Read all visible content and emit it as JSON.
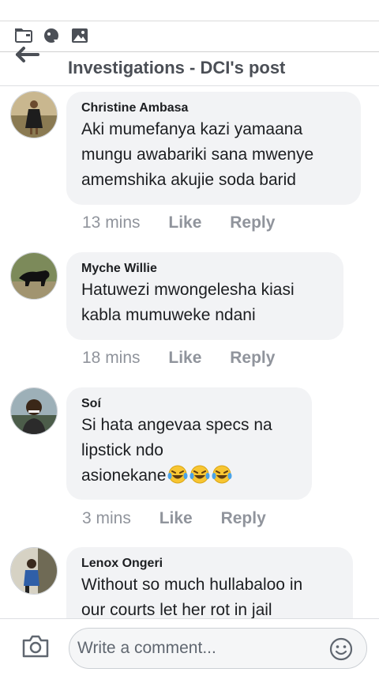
{
  "header": {
    "title": "Investigations - DCI's post"
  },
  "comments": [
    {
      "author": "Christine Ambasa",
      "lines": [
        "Aki mumefanya kazi yamaana",
        "mungu awabariki sana mwenye",
        "amemshika akujie soda barid"
      ],
      "time": "13 mins",
      "like": "Like",
      "reply": "Reply"
    },
    {
      "author": "Myche Willie",
      "lines": [
        "Hatuwezi mwongelesha kiasi",
        "kabla mumuweke ndani"
      ],
      "time": "18 mins",
      "like": "Like",
      "reply": "Reply"
    },
    {
      "author": "Soí",
      "lines": [
        "Si hata angevaa specs na",
        "lipstick ndo",
        "asionekane"
      ],
      "emoji": "laughing-tears",
      "time": "3 mins",
      "like": "Like",
      "reply": "Reply"
    },
    {
      "author": "Lenox Ongeri",
      "lines": [
        "Without so much hullabaloo in",
        "our courts let her rot in jail"
      ]
    }
  ],
  "composer": {
    "placeholder": "Write a comment..."
  },
  "colors": {
    "bubble": "#f2f3f5",
    "meta": "#90949c",
    "title": "#4b4f56"
  }
}
